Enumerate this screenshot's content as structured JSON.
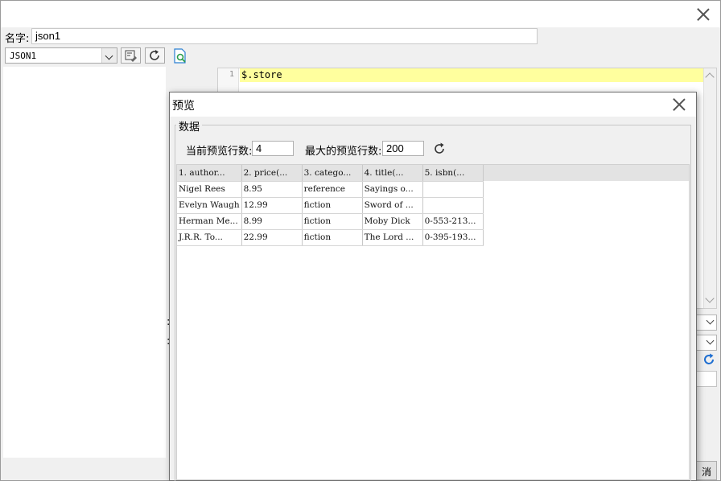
{
  "main": {
    "name_label": "名字:",
    "name_value": "json1",
    "connection_value": "JSON1",
    "editor_line_number": "1",
    "editor_code": "$.store",
    "cancel_button_partial": "消"
  },
  "dialog": {
    "title": "预览",
    "group_title": "数据",
    "current_rows_label": "当前预览行数:",
    "current_rows_value": "4",
    "max_rows_label": "最大的预览行数:",
    "max_rows_value": "200",
    "columns": [
      "1. author...",
      "2. price(...",
      "3. catego...",
      "4. title(...",
      "5. isbn(..."
    ],
    "rows": [
      [
        "Nigel Rees",
        "8.95",
        "reference",
        "Sayings o...",
        ""
      ],
      [
        "Evelyn Waugh",
        "12.99",
        "fiction",
        "Sword of ...",
        ""
      ],
      [
        "Herman Me...",
        "8.99",
        "fiction",
        "Moby Dick",
        "0-553-213..."
      ],
      [
        "J.R.R. To...",
        "22.99",
        "fiction",
        "The Lord ...",
        "0-395-193..."
      ]
    ]
  },
  "colors": {
    "editor_highlight": "#ffff9e",
    "refresh_icon": "#1f6fd1",
    "preview_icon": "#2a9d4a"
  },
  "icons": [
    "close-icon",
    "chevron-down-icon",
    "edit-connection-icon",
    "refresh-icon",
    "preview-icon"
  ]
}
